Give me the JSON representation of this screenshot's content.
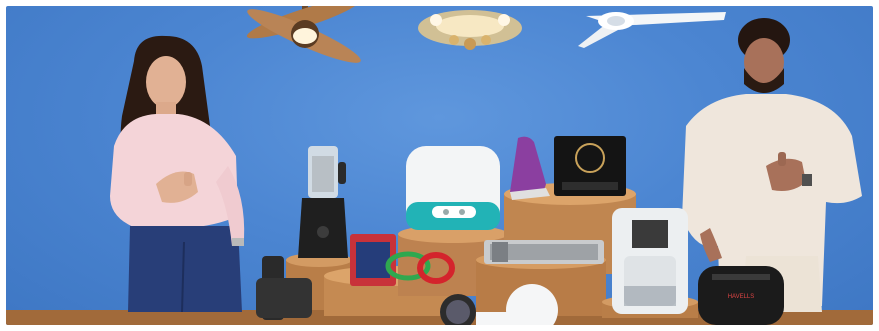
{
  "banner": {
    "alt_text": "",
    "brand_wordmark_on_airfryer": "HAVELLS",
    "colors": {
      "background": "#4c86d2",
      "wood": "#c58a52",
      "wood_dark": "#8a5a30",
      "floor": "#a16a3a"
    },
    "products": [
      "ceiling-fan-brown",
      "chandelier",
      "ceiling-fan-white",
      "mixer-grinder",
      "rice-cooker",
      "steam-iron",
      "induction-cooktop",
      "air-purifier",
      "air-fryer",
      "room-heater",
      "extension-box",
      "led-bulb",
      "hand-blender",
      "water-heater"
    ]
  }
}
